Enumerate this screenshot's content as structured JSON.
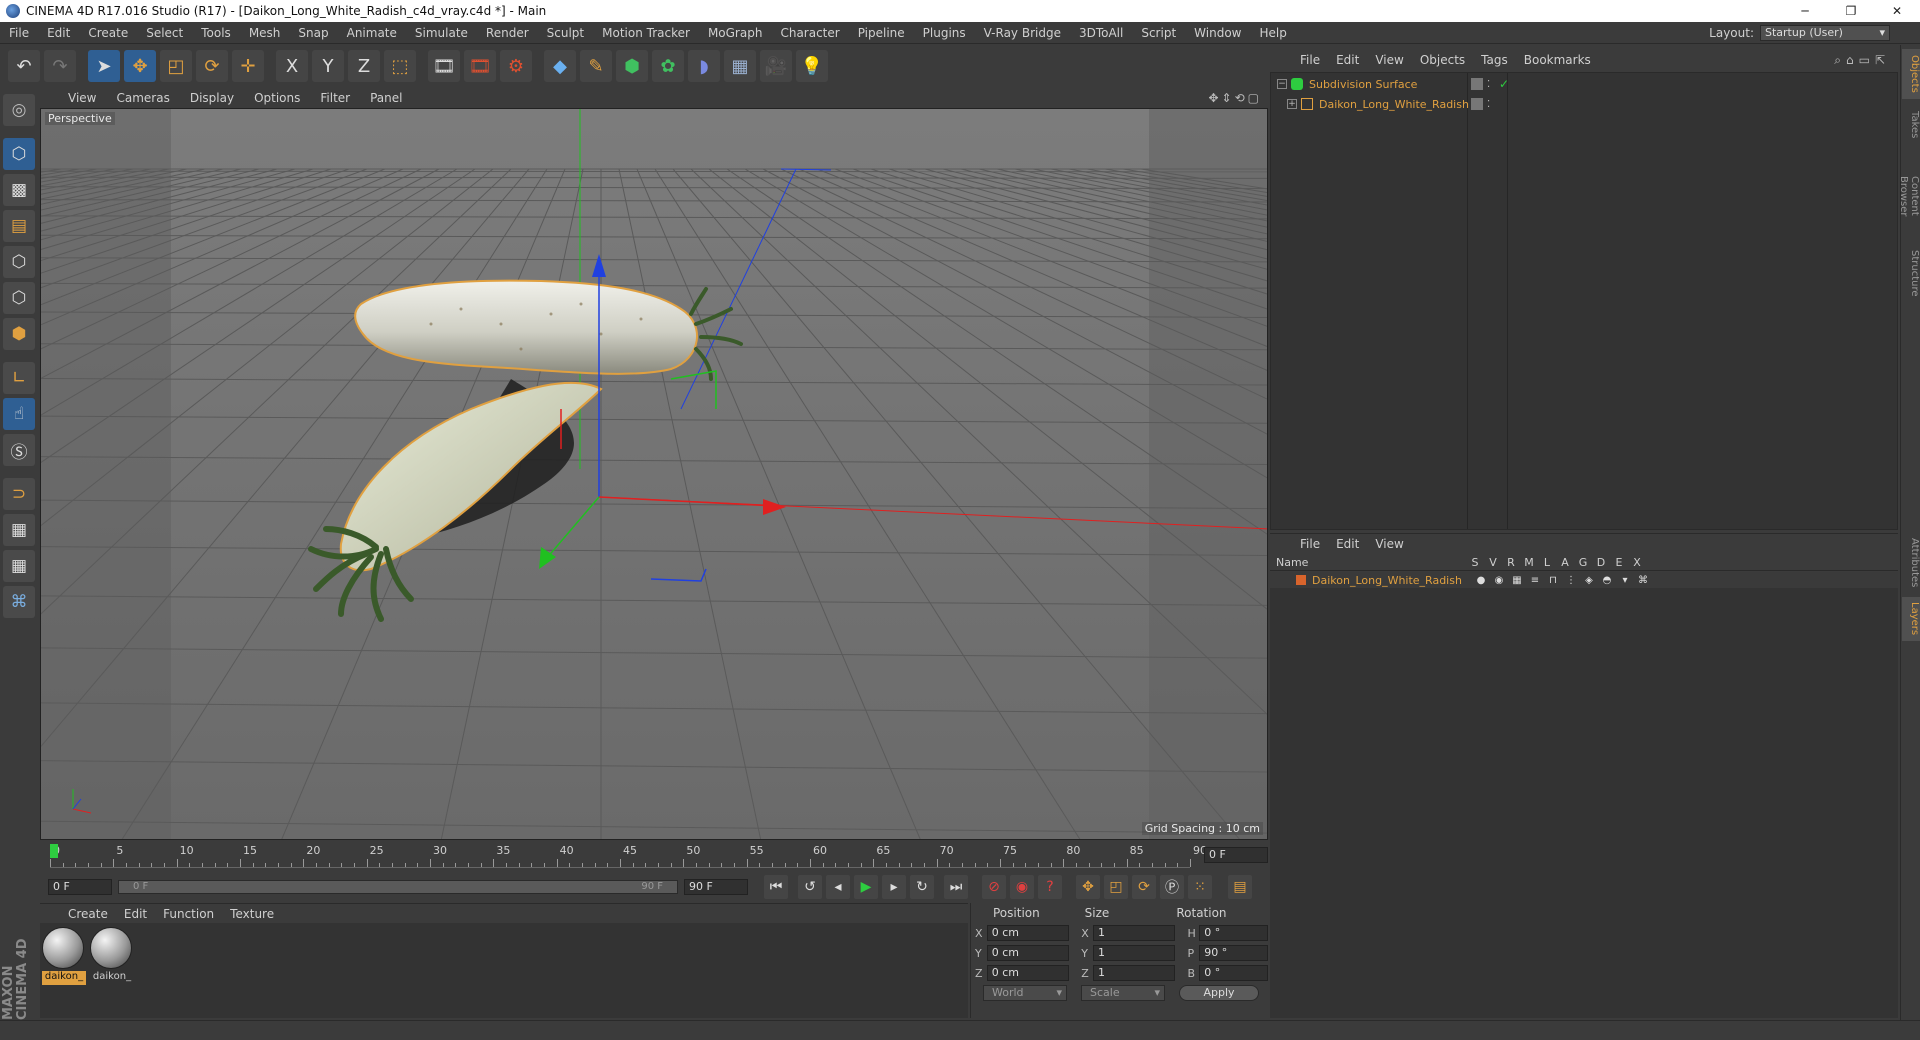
{
  "window": {
    "title": "CINEMA 4D R17.016 Studio (R17) - [Daikon_Long_White_Radish_c4d_vray.c4d *] - Main",
    "minimize": "─",
    "maximize": "❐",
    "close": "✕"
  },
  "menubar": {
    "items": [
      "File",
      "Edit",
      "Create",
      "Select",
      "Tools",
      "Mesh",
      "Snap",
      "Animate",
      "Simulate",
      "Render",
      "Sculpt",
      "Motion Tracker",
      "MoGraph",
      "Character",
      "Pipeline",
      "Plugins",
      "V-Ray Bridge",
      "3DToAll",
      "Script",
      "Window",
      "Help"
    ],
    "layout_label": "Layout:",
    "layout_value": "Startup (User)"
  },
  "toolbar": {
    "icons": [
      "undo-icon",
      "redo-icon",
      "select-arrow-icon",
      "move-icon",
      "scale-icon",
      "rotate-icon",
      "live-selection-icon",
      "x-axis-icon",
      "y-axis-icon",
      "z-axis-icon",
      "coordinate-system-icon",
      "render-view-icon",
      "render-picture-viewer-icon",
      "edit-render-settings-icon",
      "cube-icon",
      "pen-spline-icon",
      "subdivision-icon",
      "cloner-icon",
      "deformer-icon",
      "floor-icon",
      "camera-icon",
      "light-icon"
    ],
    "x_label": "X",
    "y_label": "Y",
    "z_label": "Z"
  },
  "viewport": {
    "menu": [
      "View",
      "Cameras",
      "Display",
      "Options",
      "Filter",
      "Panel"
    ],
    "nav_icons": "✥⇕⟲▢",
    "label": "Perspective",
    "grid_spacing": "Grid Spacing : 10 cm"
  },
  "timeline": {
    "ticks": [
      "0",
      "5",
      "10",
      "15",
      "20",
      "25",
      "30",
      "35",
      "40",
      "45",
      "50",
      "55",
      "60",
      "65",
      "70",
      "75",
      "80",
      "85",
      "90"
    ],
    "current_frame": "0 F"
  },
  "transport": {
    "start_frame": "0 F",
    "range_start": "0 F",
    "range_end": "90 F",
    "end_frame": "90 F"
  },
  "material_manager": {
    "menu": [
      "Create",
      "Edit",
      "Function",
      "Texture"
    ],
    "materials": [
      {
        "name": "daikon_",
        "selected": true
      },
      {
        "name": "daikon_",
        "selected": false
      }
    ]
  },
  "coordinates": {
    "headers": [
      "Position",
      "Size",
      "Rotation"
    ],
    "rows": [
      {
        "axis": "X",
        "pos": "0 cm",
        "size_axis": "X",
        "size": "1",
        "rot_axis": "H",
        "rot": "0 °"
      },
      {
        "axis": "Y",
        "pos": "0 cm",
        "size_axis": "Y",
        "size": "1",
        "rot_axis": "P",
        "rot": "90 °"
      },
      {
        "axis": "Z",
        "pos": "0 cm",
        "size_axis": "Z",
        "size": "1",
        "rot_axis": "B",
        "rot": "0 °"
      }
    ],
    "coord_system": "World",
    "mode": "Scale",
    "apply_label": "Apply"
  },
  "object_manager": {
    "menu": [
      "File",
      "Edit",
      "View",
      "Objects",
      "Tags",
      "Bookmarks"
    ],
    "objects": [
      {
        "name": "Subdivision Surface",
        "expand": "−",
        "color": "#2ecc40"
      },
      {
        "name": "Daikon_Long_White_Radish",
        "expand": "+",
        "color": "#e0a040"
      }
    ]
  },
  "side_tabs": [
    "Objects",
    "Takes",
    "Content Browser",
    "Structure",
    "Attributes",
    "Layers"
  ],
  "layer_manager": {
    "menu": [
      "File",
      "Edit",
      "View"
    ],
    "columns": [
      "Name",
      "S",
      "V",
      "R",
      "M",
      "L",
      "A",
      "G",
      "D",
      "E",
      "X"
    ],
    "layers": [
      {
        "name": "Daikon_Long_White_Radish",
        "color": "#d8642c"
      }
    ]
  },
  "brand": {
    "logo_text": "MAXON CINEMA 4D"
  },
  "colors": {
    "accent": "#e0a040",
    "selection": "#2f5f93",
    "axis_x": "#e02020",
    "axis_y": "#20c020",
    "axis_z": "#2040e0"
  }
}
